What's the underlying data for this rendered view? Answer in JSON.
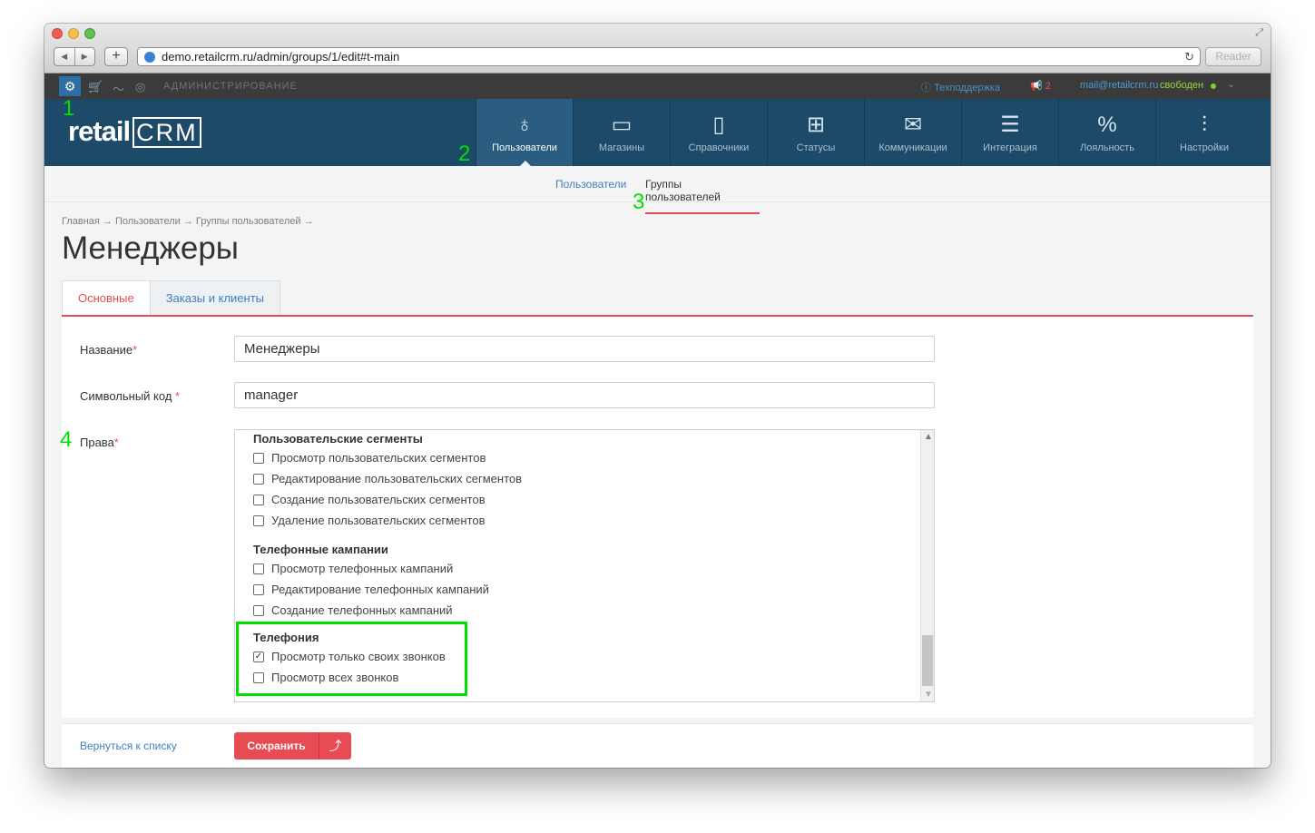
{
  "browser": {
    "url": "demo.retailcrm.ru/admin/groups/1/edit#t-main",
    "reader": "Reader"
  },
  "topbar": {
    "section": "АДМИНИСТРИРОВАНИЕ",
    "support": "Техподдержка",
    "notifications": "2",
    "email": "mail@retailcrm.ru",
    "status": "свободен"
  },
  "logo": {
    "text": "retail",
    "boxed": "CRM"
  },
  "menu": [
    "Пользователи",
    "Магазины",
    "Справочники",
    "Статусы",
    "Коммуникации",
    "Интеграция",
    "Лояльность",
    "Настройки"
  ],
  "subnav": {
    "users": "Пользователи",
    "groups": "Группы пользователей"
  },
  "breadcrumb": "Главная → Пользователи → Группы пользователей →",
  "page_title": "Менеджеры",
  "tabs": [
    "Основные",
    "Заказы и клиенты"
  ],
  "form": {
    "name_label": "Название",
    "name_value": "Менеджеры",
    "code_label": "Символьный код",
    "code_value": "manager",
    "rights_label": "Права",
    "required_mark": "*"
  },
  "rights": {
    "groups": [
      {
        "title": "Пользовательские сегменты",
        "items": [
          "Просмотр пользовательских сегментов",
          "Редактирование пользовательских сегментов",
          "Создание пользовательских сегментов",
          "Удаление пользовательских сегментов"
        ]
      },
      {
        "title": "Телефонные кампании",
        "items": [
          "Просмотр телефонных кампаний",
          "Редактирование телефонных кампаний",
          "Создание телефонных кампаний"
        ]
      },
      {
        "title": "Телефония",
        "items": [
          "Просмотр только своих звонков",
          "Просмотр всех звонков"
        ]
      }
    ],
    "checked_item": "Просмотр только своих звонков"
  },
  "annotations": [
    "1",
    "2",
    "3",
    "4"
  ],
  "footer": {
    "back": "Вернуться к списку",
    "save": "Сохранить"
  },
  "colors": {
    "accent": "#e74c55",
    "header": "#1d4a68",
    "highlight": "#00e000"
  }
}
